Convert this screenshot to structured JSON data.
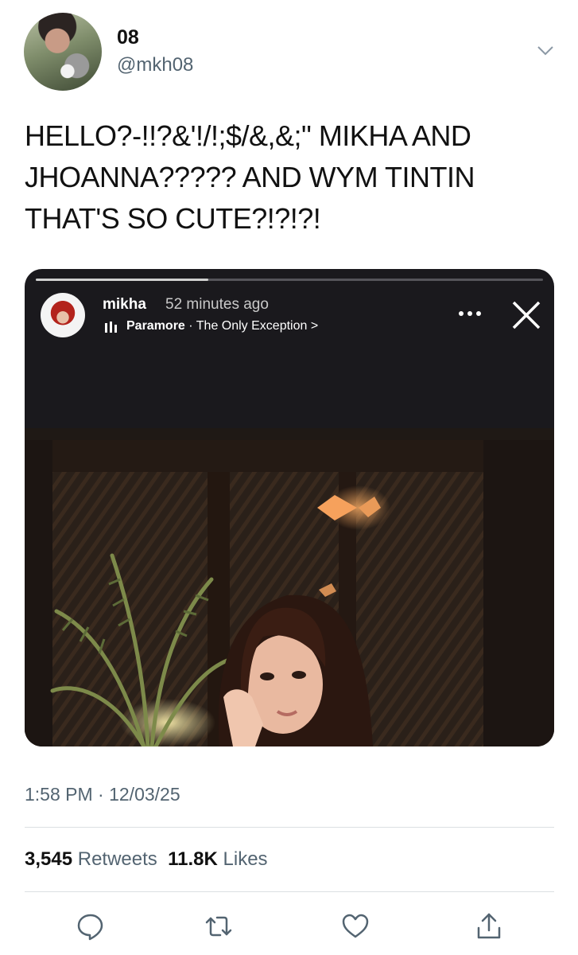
{
  "author": {
    "display_name": "08",
    "handle": "@mkh08"
  },
  "tweet_text": "HELLO?-!!?&'!/!;$/&,&;\" MIKHA AND JHOANNA????? AND WYM TINTIN THAT'S SO CUTE?!?!?!",
  "story": {
    "username": "mikha",
    "time": "52 minutes ago",
    "artist": "Paramore",
    "separator": " · ",
    "song": "The Only Exception",
    "song_arrow": " >",
    "progress": 0.34
  },
  "timestamp": "1:58 PM · 12/03/25",
  "stats": {
    "retweets_count": "3,545",
    "retweets_label": "Retweets",
    "likes_count": "11.8K",
    "likes_label": "Likes"
  },
  "icons": {
    "reply": "speech-bubble-icon",
    "retweet": "retweet-arrows-icon",
    "like": "heart-icon",
    "share": "share-upload-icon",
    "more": "chevron-down-icon"
  },
  "colors": {
    "secondary_text": "#536471",
    "story_bg": "#1a191d"
  }
}
